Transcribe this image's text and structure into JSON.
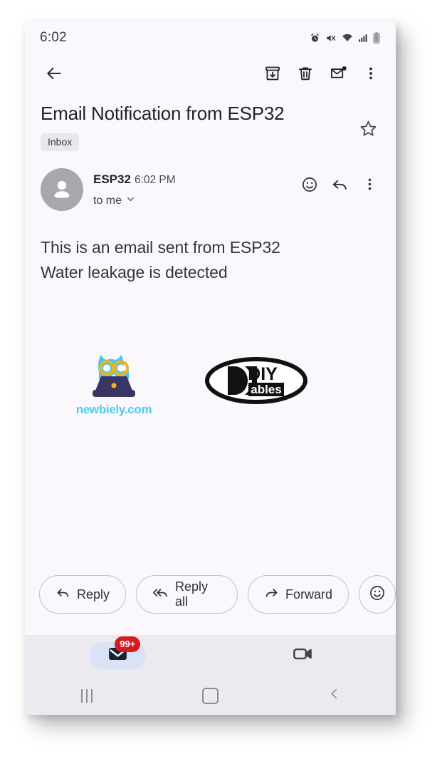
{
  "status_bar": {
    "time": "6:02",
    "icons": [
      "alarm-icon",
      "mute-icon",
      "wifi-icon",
      "signal-icon",
      "battery-icon"
    ]
  },
  "toolbar": {
    "back_label": "back-arrow-icon",
    "archive_label": "archive-icon",
    "delete_label": "delete-icon",
    "unread_label": "mark-unread-icon",
    "more_label": "more-options-icon"
  },
  "email": {
    "subject": "Email Notification from ESP32",
    "label_chip": "Inbox",
    "starred": false,
    "sender_name": "ESP32",
    "sent_time": "6:02 PM",
    "recipient": "to me",
    "body_lines": [
      "This is an email sent from ESP32",
      "Water leakage is detected"
    ],
    "signature": {
      "newbiely_caption": "newbiely.com",
      "diyables_top": "DIY",
      "diyables_bottom": "ables"
    }
  },
  "actions": {
    "reply": "Reply",
    "reply_all": "Reply all",
    "forward": "Forward",
    "emoji": "emoji-reaction-icon"
  },
  "bottom_nav": {
    "mail_badge": "99+",
    "mail_label": "mail-tab",
    "meet_label": "meet-tab"
  },
  "system_nav": {
    "recents": "recents-button",
    "home": "home-button",
    "back": "back-button"
  },
  "colors": {
    "page_bg": "#faf8fd",
    "nav_bg": "#eceaf0",
    "badge_red": "#d71920",
    "mail_pill": "#dbe1f7",
    "newbiely_cyan": "#49cdf0",
    "owl_body": "#4fc6e8",
    "owl_glasses": "#f0b323",
    "laptop": "#3b3564"
  }
}
